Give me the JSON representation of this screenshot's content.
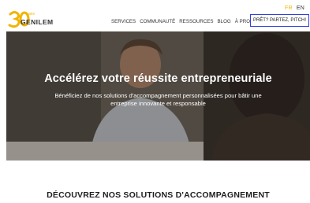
{
  "lang": {
    "fr": "FR",
    "en": "EN"
  },
  "logo": {
    "number": "30",
    "word": "GENILEM",
    "ans": "ans"
  },
  "nav": {
    "items": [
      "SERVICES",
      "COMMUNAUTÉ",
      "RESSOURCES",
      "BLOG",
      "À PROPOS"
    ],
    "cta": "PRÊT? PARTEZ, PITCH!"
  },
  "hero": {
    "title": "Accélérez votre réussite entrepreneuriale",
    "subtitle": "Bénéficiez de nos solutions d'accompagnement personnalisées pour bâtir une entreprise innovante et responsable"
  },
  "section": {
    "title": "DÉCOUVREZ NOS SOLUTIONS D'ACCOMPAGNEMENT"
  },
  "colors": {
    "accent": "#f0b400",
    "cta_border": "#2f3fd9"
  }
}
